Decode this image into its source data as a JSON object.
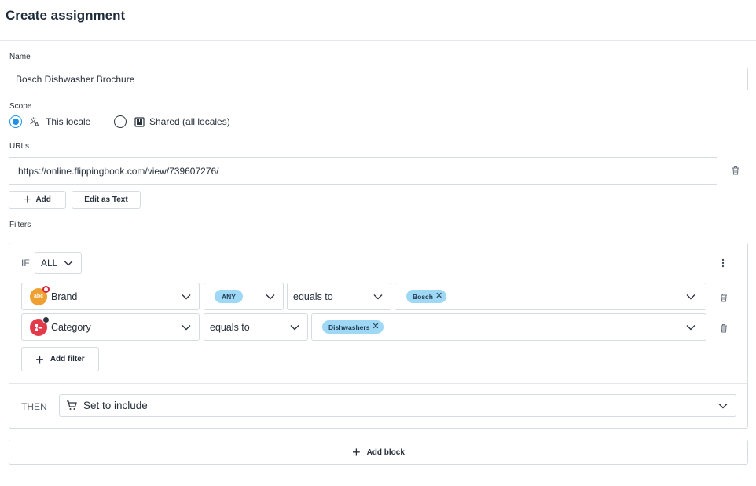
{
  "page": {
    "title": "Create assignment"
  },
  "name_field": {
    "label": "Name",
    "value": "Bosch Dishwasher Brochure"
  },
  "scope": {
    "label": "Scope",
    "options": [
      {
        "label": "This locale",
        "selected": true,
        "icon": "translate-icon"
      },
      {
        "label": "Shared (all locales)",
        "selected": false,
        "icon": "shared-icon"
      }
    ]
  },
  "urls": {
    "label": "URLs",
    "items": [
      "https://online.flippingbook.com/view/739607276/"
    ],
    "add_label": "Add",
    "edit_label": "Edit as Text"
  },
  "filters": {
    "label": "Filters",
    "if_label": "IF",
    "match_mode": "ALL",
    "rows": [
      {
        "attribute": "Brand",
        "attribute_icon": "abc-text-attribute-icon",
        "quantifier": "ANY",
        "operator": "equals to",
        "values": [
          "Bosch"
        ]
      },
      {
        "attribute": "Category",
        "attribute_icon": "category-tree-icon",
        "operator": "equals to",
        "values": [
          "Dishwashers"
        ]
      }
    ],
    "add_filter_label": "Add filter",
    "then_label": "THEN",
    "then_action": "Set to include",
    "then_icon": "cart-icon"
  },
  "add_block_label": "Add block",
  "colors": {
    "accent": "#1e90e6",
    "chip": "#9ed8f4",
    "border": "#d6dbe1"
  }
}
